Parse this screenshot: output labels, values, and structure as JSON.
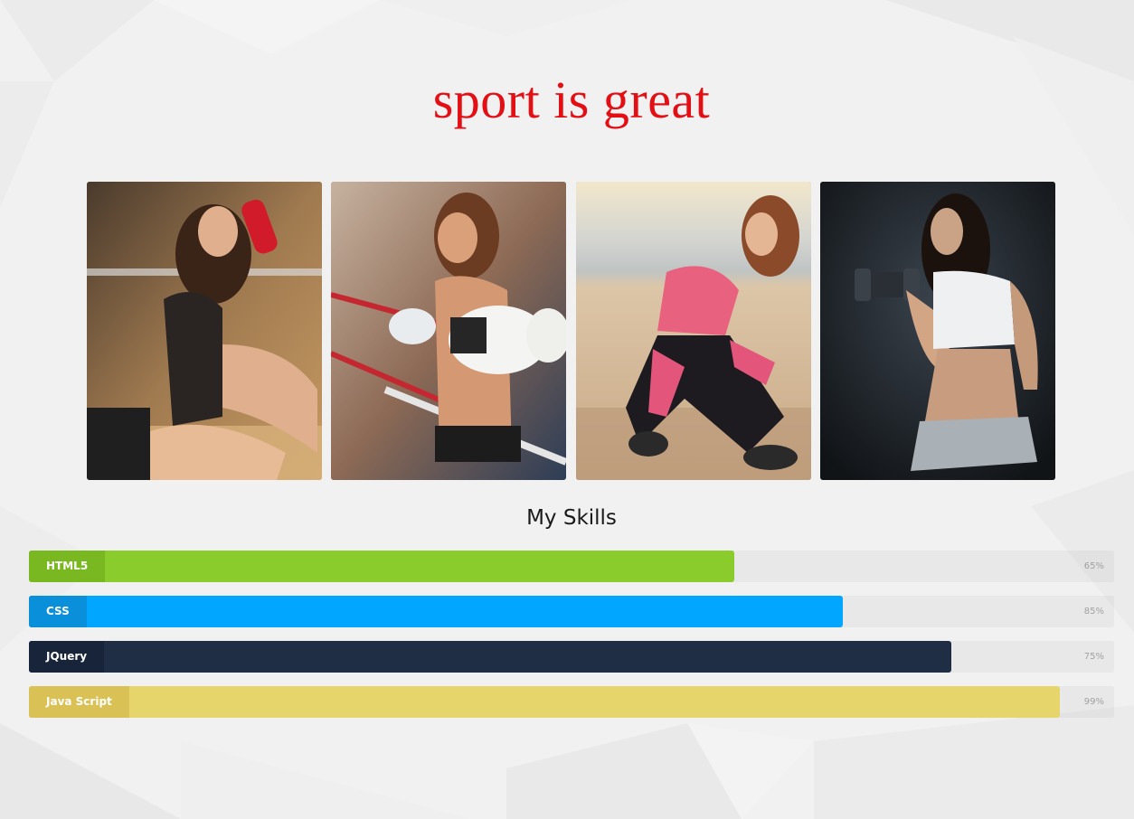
{
  "header": {
    "title": "sport is great"
  },
  "gallery": {
    "photos": [
      {
        "name": "woman-with-red-boxing-wrap-photo"
      },
      {
        "name": "woman-with-boxing-gloves-photo"
      },
      {
        "name": "woman-crouching-on-beach-photo"
      },
      {
        "name": "woman-lifting-dumbbell-photo"
      }
    ]
  },
  "skills": {
    "title": "My Skills",
    "items": [
      {
        "label": "HTML5",
        "percent_text": "65%",
        "fill_fraction": 0.65,
        "color": "#89cc2b",
        "label_color": "#7ab821"
      },
      {
        "label": "CSS",
        "percent_text": "85%",
        "fill_fraction": 0.75,
        "color": "#00a6ff",
        "label_color": "#0a8fdb"
      },
      {
        "label": "JQuery",
        "percent_text": "75%",
        "fill_fraction": 0.85,
        "color": "#1f2d45",
        "label_color": "#18243a"
      },
      {
        "label": "Java Script",
        "percent_text": "99%",
        "fill_fraction": 0.95,
        "color": "#e6d56a",
        "label_color": "#d9c155"
      }
    ]
  },
  "colors": {
    "title": "#e30f14",
    "background": "#f1f1f2"
  }
}
